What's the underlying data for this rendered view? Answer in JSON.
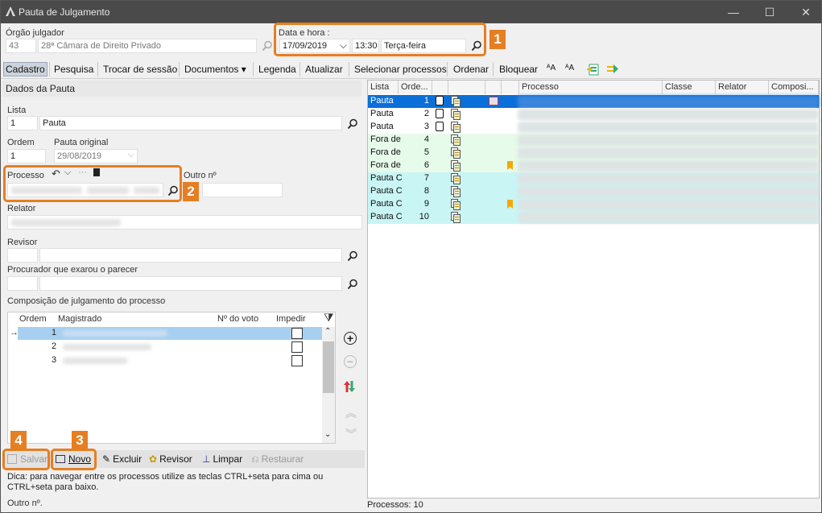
{
  "window": {
    "title": "Pauta de Julgamento",
    "minimize": "—",
    "maximize": "☐",
    "close": "✕"
  },
  "orgao": {
    "label": "Órgão julgador",
    "code": "43",
    "name": "28ª Câmara de Direito Privado"
  },
  "datahora": {
    "label": "Data e hora :",
    "date": "17/09/2019",
    "time": "13:30",
    "weekday": "Terça-feira"
  },
  "badges": {
    "b1": "1",
    "b2": "2",
    "b3": "3",
    "b4": "4"
  },
  "toolbar": {
    "items": [
      "Cadastro",
      "Pesquisa",
      "Trocar de sessão",
      "Documentos ▾",
      "Legenda",
      "Atualizar",
      "Selecionar processos",
      "Ordenar",
      "Bloquear"
    ],
    "icon_a1": "ᴬA",
    "icon_a2": "ᴬA"
  },
  "dados": {
    "section_title": "Dados da Pauta",
    "lista_label": "Lista",
    "lista_code": "1",
    "lista_name": "Pauta",
    "ordem_label": "Ordem",
    "ordem_value": "1",
    "pauta_original_label": "Pauta original",
    "pauta_original_value": "29/08/2019",
    "processo_label": "Processo",
    "outro_label": "Outro nº",
    "relator_label": "Relator",
    "revisor_label": "Revisor",
    "procurador_label": "Procurador que exarou o parecer",
    "composicao_label": "Composição de julgamento do processo"
  },
  "composicao": {
    "headers": [
      "Ordem",
      "Magistrado",
      "Nº do voto",
      "Impedir"
    ],
    "rows": [
      {
        "ordem": "1",
        "current": true
      },
      {
        "ordem": "2",
        "current": false
      },
      {
        "ordem": "3",
        "current": false
      }
    ]
  },
  "bottom": {
    "salvar": "Salvar",
    "novo": "Novo",
    "excluir": "Excluir",
    "revisor": "Revisor",
    "limpar": "Limpar",
    "restaurar": "Restaurar"
  },
  "tip": "Dica: para navegar entre os processos utilize as teclas CTRL+seta para cima ou CTRL+seta para baixo.",
  "outro_bottom": "Outro nº.",
  "grid": {
    "headers": [
      "Lista",
      "Orde...",
      "Processo",
      "Classe",
      "Relator",
      "Composi..."
    ],
    "rows": [
      {
        "lista": "Pauta",
        "ordem": "1",
        "bg": "#0a6fd8",
        "sel": true,
        "flag": false,
        "red": true,
        "docs": 2
      },
      {
        "lista": "Pauta",
        "ordem": "2",
        "bg": "#ffffff",
        "sel": false,
        "flag": false,
        "red": false,
        "docs": 2
      },
      {
        "lista": "Pauta",
        "ordem": "3",
        "bg": "#ffffff",
        "sel": false,
        "flag": false,
        "red": false,
        "docs": 2
      },
      {
        "lista": "Fora de",
        "ordem": "4",
        "bg": "#e6fbe9",
        "sel": false,
        "flag": false,
        "red": false,
        "docs": 1
      },
      {
        "lista": "Fora de",
        "ordem": "5",
        "bg": "#e6fbe9",
        "sel": false,
        "flag": false,
        "red": false,
        "docs": 1
      },
      {
        "lista": "Fora de",
        "ordem": "6",
        "bg": "#e6fbe9",
        "sel": false,
        "flag": true,
        "red": false,
        "docs": 1
      },
      {
        "lista": "Pauta C",
        "ordem": "7",
        "bg": "#c9f5f5",
        "sel": false,
        "flag": false,
        "red": false,
        "docs": 1
      },
      {
        "lista": "Pauta C",
        "ordem": "8",
        "bg": "#c9f5f5",
        "sel": false,
        "flag": false,
        "red": false,
        "docs": 1
      },
      {
        "lista": "Pauta C",
        "ordem": "9",
        "bg": "#c9f5f5",
        "sel": false,
        "flag": true,
        "red": false,
        "docs": 1
      },
      {
        "lista": "Pauta C",
        "ordem": "10",
        "bg": "#c9f5f5",
        "sel": false,
        "flag": false,
        "red": false,
        "docs": 1
      }
    ]
  },
  "status": {
    "processos": "Processos: 10"
  },
  "colors": {
    "accent": "#e67e22",
    "selection": "#0a6fd8",
    "flag": "#f5a800"
  }
}
